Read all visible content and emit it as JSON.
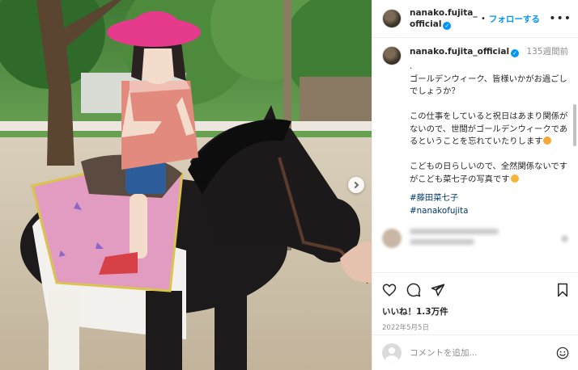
{
  "post": {
    "username": "nanako.fujita_official",
    "follow_label": "フォローする",
    "more_icon": "more-options-icon",
    "caption": {
      "time_ago": "135週間前",
      "lines": ".\nゴールデンウィーク、皆様いかがお過ごしでしょうか？\n\nこの仕事をしていると祝日はあまり関係がないので、世間がゴールデンウィークであるということを忘れていたりします",
      "lines2": "こどもの日らしいので、全然関係ないですがこども菜七子の写真です",
      "hashtags": [
        "#藤田菜七子",
        "#nanakofujita"
      ]
    },
    "likes_label": "いいね！1.3万件",
    "date_label": "2022年5月5日",
    "comment_placeholder": "コメントを追加...",
    "icons": [
      "heart-icon",
      "comment-icon",
      "share-icon",
      "save-icon",
      "emoji-icon"
    ],
    "accent_color": "#0095f6"
  }
}
